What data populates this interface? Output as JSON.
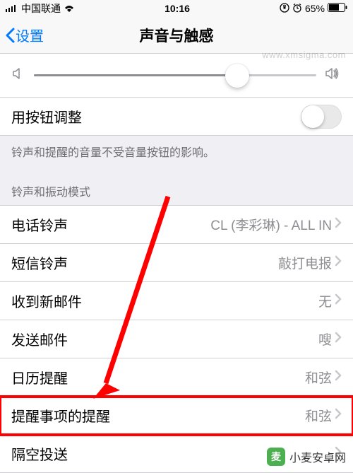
{
  "status": {
    "carrier": "中国联通",
    "time": "10:16",
    "battery": "65%"
  },
  "nav": {
    "back": "设置",
    "title": "声音与触感"
  },
  "slider": {
    "value_pct": 72
  },
  "toggle_row": {
    "label": "用按钮调整"
  },
  "footer_note": "铃声和提醒的音量不受音量按钮的影响。",
  "section_header": "铃声和振动模式",
  "rows": [
    {
      "label": "电话铃声",
      "value": "CL (李彩琳) - ALL IN"
    },
    {
      "label": "短信铃声",
      "value": "敲打电报"
    },
    {
      "label": "收到新邮件",
      "value": "无"
    },
    {
      "label": "发送邮件",
      "value": "嗖"
    },
    {
      "label": "日历提醒",
      "value": "和弦"
    },
    {
      "label": "提醒事项的提醒",
      "value": "和弦"
    },
    {
      "label": "隔空投送",
      "value": ""
    }
  ],
  "watermark": {
    "badge": "麦",
    "text": "小麦安卓网",
    "url": "www.xmsigma.com"
  }
}
